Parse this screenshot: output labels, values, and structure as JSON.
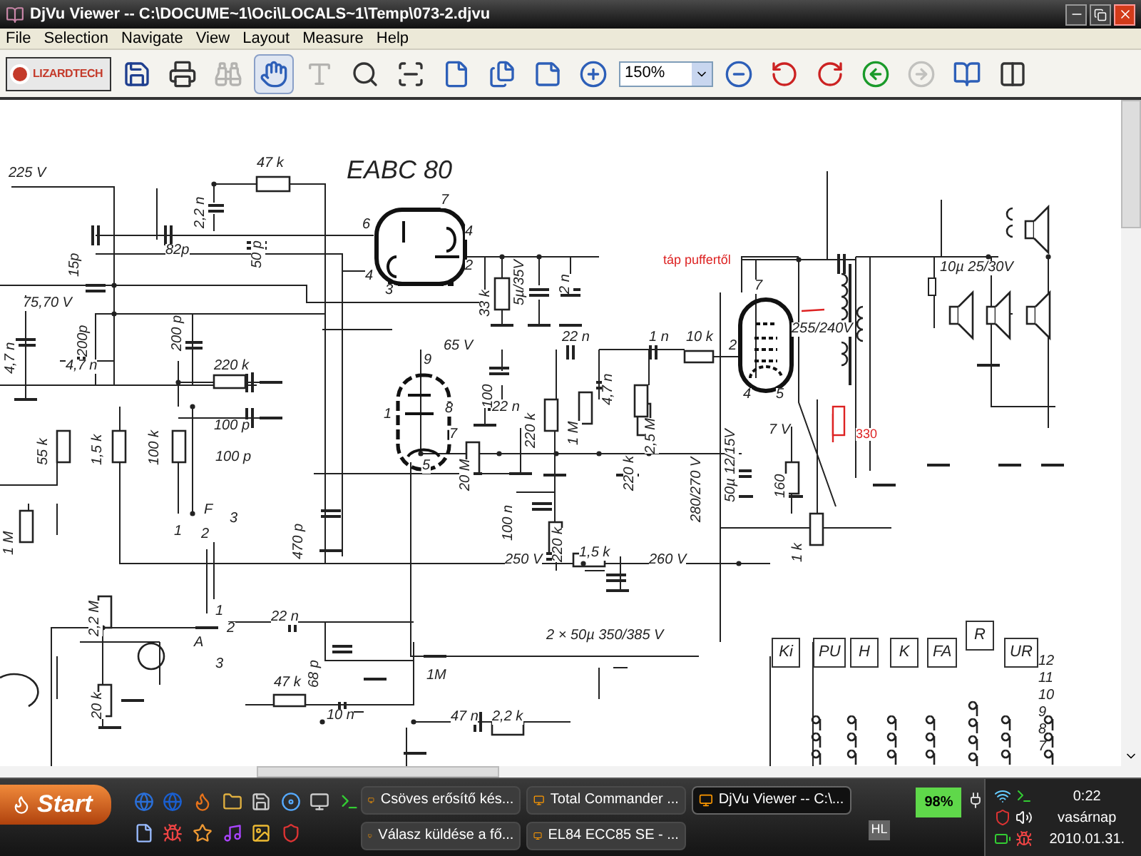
{
  "window": {
    "title": "DjVu Viewer -- C:\\DOCUME~1\\Oci\\LOCALS~1\\Temp\\073-2.djvu"
  },
  "menu": [
    "File",
    "Selection",
    "Navigate",
    "View",
    "Layout",
    "Measure",
    "Help"
  ],
  "toolbar": {
    "logo": "LIZARDTECH",
    "left_buttons": [
      {
        "kind": "save",
        "disabled": false,
        "selected": false
      },
      {
        "kind": "print",
        "disabled": false,
        "selected": false
      },
      {
        "kind": "find",
        "disabled": true,
        "selected": false
      },
      {
        "kind": "hand",
        "disabled": false,
        "selected": true
      },
      {
        "kind": "text",
        "disabled": true,
        "selected": false
      },
      {
        "kind": "zoom-rect",
        "disabled": false,
        "selected": false
      },
      {
        "kind": "scan",
        "disabled": false,
        "selected": false
      },
      {
        "kind": "page",
        "disabled": false,
        "selected": false
      },
      {
        "kind": "pages",
        "disabled": false,
        "selected": false
      },
      {
        "kind": "fit",
        "disabled": false,
        "selected": false
      },
      {
        "kind": "zoom-in",
        "disabled": false,
        "selected": false
      }
    ],
    "zoom": "150%",
    "right_buttons": [
      {
        "kind": "zoom-out",
        "disabled": false,
        "selected": false
      },
      {
        "kind": "rotate-left",
        "disabled": false,
        "selected": false
      },
      {
        "kind": "rotate-right",
        "disabled": false,
        "selected": false
      },
      {
        "kind": "back",
        "disabled": false,
        "selected": false
      },
      {
        "kind": "forward",
        "disabled": true,
        "selected": false
      },
      {
        "kind": "thumbnails",
        "disabled": false,
        "selected": false
      },
      {
        "kind": "outline",
        "disabled": false,
        "selected": false
      }
    ]
  },
  "document": {
    "tube_title": "EABC 80",
    "labels": [
      "225 V",
      "47 k",
      "2,2 n",
      "15p",
      "82p",
      "50 p",
      "6",
      "7",
      "4",
      "2",
      "4",
      "3",
      "75,70 V",
      "200p",
      "200 p",
      "33 k",
      "5µ/35V",
      "2 n",
      "4,7 n",
      "65 V",
      "22 n",
      "1 n",
      "10 k",
      "2",
      "7",
      "255/240V",
      "10µ 25/30V",
      "4,7 n",
      "220 k",
      "9",
      "100",
      "4,7 n",
      "22 n",
      "1",
      "8",
      "1 M",
      "220 k",
      "2,5 M",
      "100 p",
      "4",
      "5",
      "7 V",
      "100 p",
      "7",
      "55 k",
      "1,5 k",
      "100 k",
      "20 M",
      "5",
      "220 k",
      "50µ 12/15V",
      "160",
      "1 M",
      "F",
      "1",
      "2",
      "3",
      "470 p",
      "100 n",
      "220 k",
      "280/270 V",
      "1 k",
      "250 V",
      "1,5 k",
      "260 V",
      "2,2 M",
      "1",
      "2",
      "22 n",
      "A",
      "68 p",
      "3",
      "47 k",
      "1M",
      "20 k",
      "10 n",
      "47 n",
      "2,2 k",
      "2 × 50µ 350/385 V"
    ],
    "notes": [
      "táp puffertől",
      "330"
    ],
    "switch_labels": [
      "Ki",
      "PU",
      "H",
      "K",
      "FA",
      "R",
      "UR"
    ],
    "row_numbers": [
      "12",
      "11",
      "10",
      "9",
      "8",
      "7"
    ]
  },
  "taskbar": {
    "start": "Start",
    "tasks": [
      {
        "label": "Csöves erősítő kés...",
        "selected": false
      },
      {
        "label": "Total Commander ...",
        "selected": false
      },
      {
        "label": "DjVu Viewer -- C:\\...",
        "selected": true
      },
      {
        "label": "Válasz küldése a fő...",
        "selected": false
      },
      {
        "label": "EL84 ECC85 SE - ...",
        "selected": false
      }
    ],
    "battery": "98%",
    "hl": "HL",
    "clock": {
      "time": "0:22",
      "day": "vasárnap",
      "date": "2010.01.31."
    }
  }
}
